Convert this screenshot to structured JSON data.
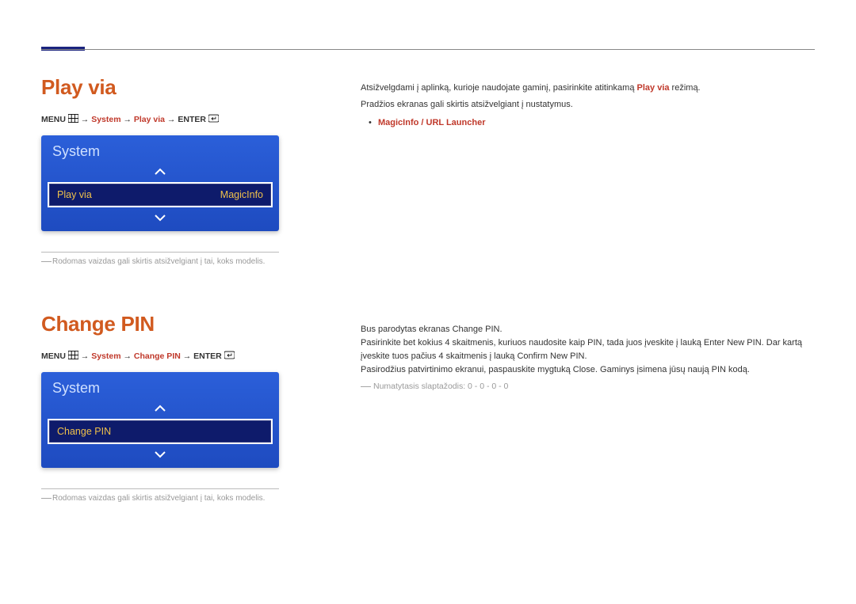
{
  "section1": {
    "title": "Play via",
    "breadcrumb": {
      "prefix": "MENU",
      "part_system": "System",
      "part_item": "Play via",
      "part_enter": "ENTER"
    },
    "osd": {
      "title": "System",
      "row_label": "Play via",
      "row_value": "MagicInfo"
    },
    "footnote": "Rodomas vaizdas gali skirtis atsižvelgiant į tai, koks modelis.",
    "body": {
      "p1_a": "Atsižvelgdami į aplinką, kurioje naudojate gaminį, pasirinkite atitinkamą ",
      "p1_hl": "Play via",
      "p1_b": " režimą.",
      "p2": "Pradžios ekranas gali skirtis atsižvelgiant į nustatymus.",
      "bullet": "MagicInfo / URL Launcher"
    }
  },
  "section2": {
    "title": "Change PIN",
    "breadcrumb": {
      "prefix": "MENU",
      "part_system": "System",
      "part_item": "Change PIN",
      "part_enter": "ENTER"
    },
    "osd": {
      "title": "System",
      "row_label": "Change PIN"
    },
    "footnote": "Rodomas vaizdas gali skirtis atsižvelgiant į tai, koks modelis.",
    "body": {
      "p1_a": "Bus parodytas ekranas ",
      "p1_hl": "Change PIN",
      "p1_b": ".",
      "p2_a": "Pasirinkite bet kokius 4 skaitmenis, kuriuos naudosite kaip PIN, tada juos įveskite į lauką ",
      "p2_hl1": "Enter New PIN",
      "p2_b": ". Dar kartą įveskite tuos pačius 4 skaitmenis į lauką ",
      "p2_hl2": "Confirm New PIN",
      "p2_c": ".",
      "p3_a": "Pasirodžius patvirtinimo ekranui, paspauskite mygtuką ",
      "p3_hl": "Close",
      "p3_b": ". Gaminys įsimena jūsų naują PIN kodą.",
      "note": "Numatytasis slaptažodis: 0 - 0 - 0 - 0"
    }
  },
  "arrows": " → "
}
